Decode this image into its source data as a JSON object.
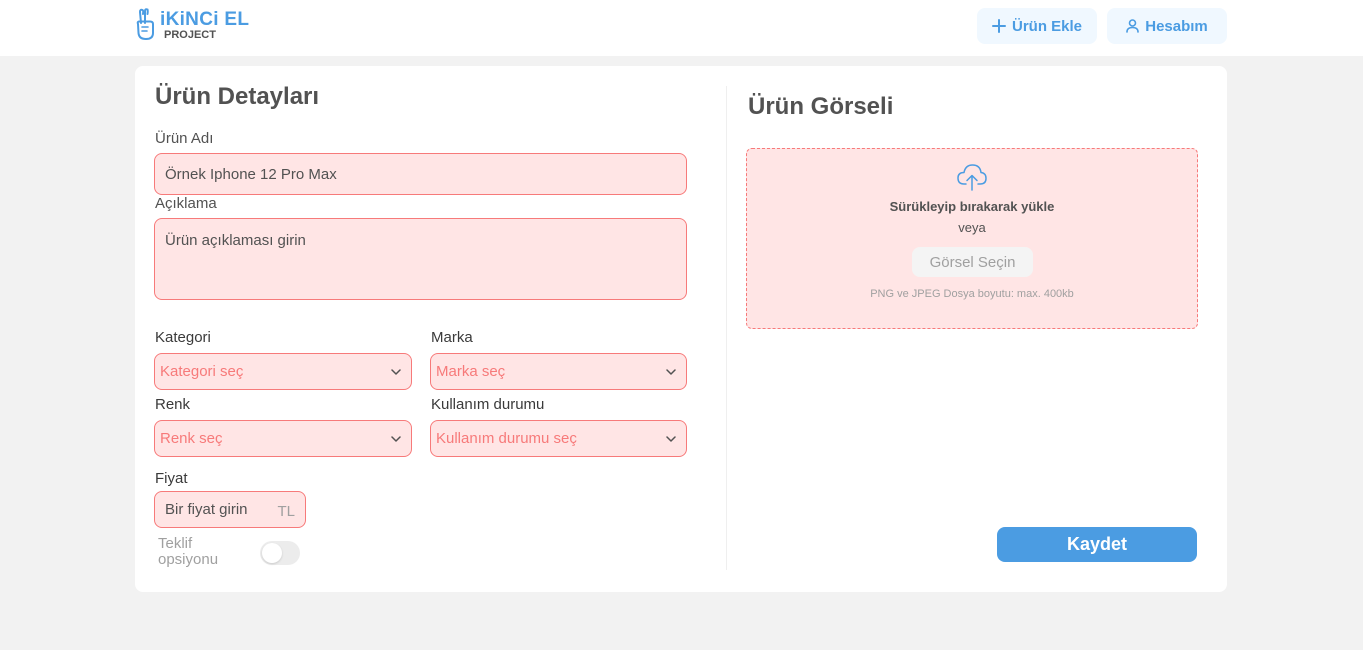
{
  "brand": {
    "name": "iKiNCi EL",
    "sub": "PROJECT"
  },
  "nav": {
    "add_product": "Ürün Ekle",
    "account": "Hesabım"
  },
  "colors": {
    "accent": "#4b9ce2",
    "error_bg": "#ffe5e5",
    "error_border": "#f77a7a"
  },
  "details": {
    "title": "Ürün Detayları",
    "name_label": "Ürün Adı",
    "name_value": "Örnek Iphone 12 Pro Max",
    "description_label": "Açıklama",
    "description_value": "Ürün açıklaması girin",
    "category_label": "Kategori",
    "category_value": "Kategori seç",
    "brand_label": "Marka",
    "brand_value": "Marka seç",
    "color_label": "Renk",
    "color_value": "Renk seç",
    "condition_label": "Kullanım durumu",
    "condition_value": "Kullanım durumu seç",
    "price_label": "Fiyat",
    "price_placeholder": "Bir fiyat girin",
    "price_currency": "TL",
    "offer_label": "Teklif opsiyonu",
    "offer_enabled": false
  },
  "image": {
    "title": "Ürün Görseli",
    "drop_title": "Sürükleyip bırakarak yükle",
    "or": "veya",
    "select_button": "Görsel Seçin",
    "hint": "PNG ve JPEG Dosya boyutu: max. 400kb",
    "upload_icon": "cloud-upload-icon"
  },
  "save_button": "Kaydet"
}
